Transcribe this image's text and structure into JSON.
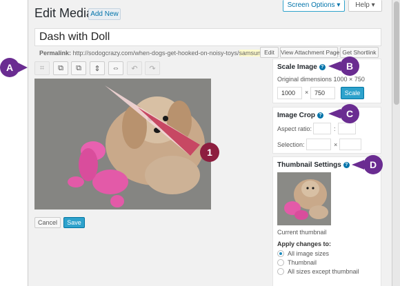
{
  "header": {
    "title": "Edit Media",
    "add_new_label": "Add New",
    "screen_options_label": "Screen Options",
    "help_label": "Help"
  },
  "title_field": {
    "value": "Dash with Doll"
  },
  "permalink": {
    "label": "Permalink:",
    "url_prefix": "http://sodogcrazy.com/when-dogs-get-hooked-on-noisy-toys/",
    "url_highlight": "samsung",
    "url_suffix": "/",
    "edit_label": "Edit",
    "view_attachment_label": "View Attachment Page",
    "shortlink_label": "Get Shortlink"
  },
  "toolbar": {
    "crop_icon": "crop-icon",
    "rotate_left_icon": "rotate-left-icon",
    "rotate_right_icon": "rotate-right-icon",
    "flip_vertical_icon": "flip-vertical-icon",
    "flip_horizontal_icon": "flip-horizontal-icon",
    "undo_icon": "undo-icon",
    "redo_icon": "redo-icon"
  },
  "actions": {
    "cancel_label": "Cancel",
    "save_label": "Save"
  },
  "scale_image": {
    "title": "Scale Image",
    "original_dimensions": "Original dimensions 1000 × 750",
    "width_value": "1000",
    "times": "×",
    "height_value": "750",
    "button_label": "Scale"
  },
  "image_crop": {
    "title": "Image Crop",
    "aspect_ratio_label": "Aspect ratio:",
    "colon": ":",
    "selection_label": "Selection:",
    "times": "×"
  },
  "thumbnail_settings": {
    "title": "Thumbnail Settings",
    "current_label": "Current thumbnail",
    "apply_label": "Apply changes to:",
    "options": [
      "All image sizes",
      "Thumbnail",
      "All sizes except thumbnail"
    ],
    "selected_option": "All image sizes"
  },
  "callouts": {
    "a": "A",
    "b": "B",
    "c": "C",
    "d": "D",
    "one": "1"
  },
  "colors": {
    "accent": "#2ea2cc",
    "link": "#0073aa",
    "callout_red": "#8d1e3f",
    "callout_purple": "#6a2c91"
  }
}
